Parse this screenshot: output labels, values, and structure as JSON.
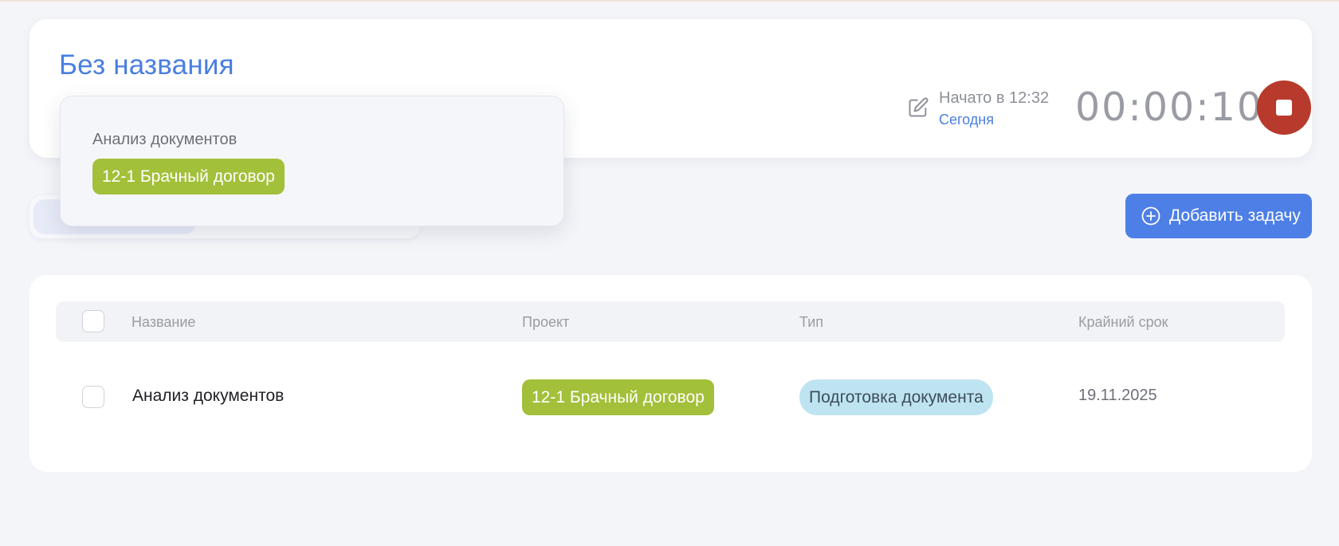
{
  "timer": {
    "title": "Без названия",
    "started_text": "Начато в 12:32",
    "started_day": "Сегодня",
    "elapsed": "00:00:10",
    "stop_color": "#b83a2c"
  },
  "popover": {
    "task_name": "Анализ документов",
    "project_tag": "12-1 Брачный договор"
  },
  "toolbar": {
    "add_task_label": "Добавить задачу"
  },
  "table": {
    "headers": [
      "Название",
      "Проект",
      "Тип",
      "Крайний срок"
    ],
    "rows": [
      {
        "name": "Анализ документов",
        "project": "12-1 Брачный договор",
        "type": "Подготовка документа",
        "deadline": "19.11.2025"
      }
    ]
  },
  "colors": {
    "accent": "#4a7fe0",
    "project_tag": "#a2c03a",
    "type_tag": "#bfe4f1",
    "button": "#4d7fe6"
  },
  "icons": {
    "edit": "pencil-edit-icon",
    "stop": "stop-square-icon",
    "add": "plus-circle-icon"
  }
}
